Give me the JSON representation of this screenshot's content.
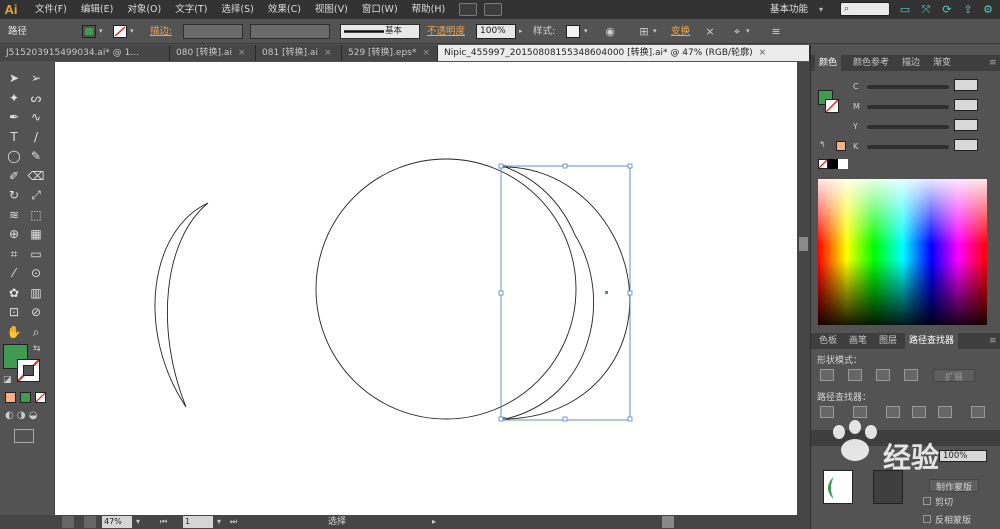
{
  "app": {
    "logo": "Ai"
  },
  "menu": [
    "文件(F)",
    "编辑(E)",
    "对象(O)",
    "文字(T)",
    "选择(S)",
    "效果(C)",
    "视图(V)",
    "窗口(W)",
    "帮助(H)"
  ],
  "workspace": {
    "label": "基本功能",
    "arrow": "▾"
  },
  "controlbar": {
    "selection_label": "路径",
    "stroke_label": "描边",
    "stroke_sep": ":",
    "brush_label": "基本",
    "opacity_label": "不透明度",
    "opacity_value": "100%",
    "style_label": "样式",
    "style_sep": ":",
    "transform_label": "变换",
    "fill_color": "#3e9b4f"
  },
  "tabs": [
    {
      "label": "J515203915499034.ai* @ 1...",
      "active": false
    },
    {
      "label": "080 [转换].ai",
      "active": false
    },
    {
      "label": "081 [转换].ai",
      "active": false
    },
    {
      "label": "529 [转换].eps*",
      "active": false
    },
    {
      "label": "Nipic_455997_20150808155348604000 [转换].ai* @ 47% (RGB/轮廓)",
      "active": true
    }
  ],
  "tab_close": "×",
  "tools": [
    "selection-tool",
    "direct-selection-tool",
    "magic-wand-tool",
    "lasso-tool",
    "pen-tool",
    "curvature-tool",
    "type-tool",
    "line-tool",
    "ellipse-tool",
    "paintbrush-tool",
    "pencil-tool",
    "eraser-tool",
    "rotate-tool",
    "scale-tool",
    "warp-tool",
    "free-transform-tool",
    "shape-builder-tool",
    "perspective-tool",
    "mesh-tool",
    "gradient-tool",
    "eyedropper-tool",
    "blend-tool",
    "symbol-sprayer-tool",
    "graph-tool",
    "artboard-tool",
    "slice-tool",
    "hand-tool",
    "zoom-tool"
  ],
  "tool_glyphs": [
    "➤",
    "➢",
    "✦",
    "ᔕ",
    "✒",
    "∿",
    "T",
    "/",
    "◯",
    "✎",
    "✐",
    "⌫",
    "↻",
    "⤢",
    "≋",
    "⬚",
    "⊕",
    "▦",
    "⌗",
    "▭",
    "⁄",
    "⊙",
    "✿",
    "▥",
    "⊡",
    "⊘",
    "✋",
    "⌕"
  ],
  "fill_color": "#3e9b4f",
  "statusbar": {
    "zoom": "47%",
    "page": "1",
    "tool": "选择"
  },
  "color_panel": {
    "tabs": [
      "颜色",
      "颜色参考",
      "描边",
      "渐变"
    ],
    "channels": [
      "C",
      "M",
      "Y",
      "K"
    ],
    "fill_color": "#3e9b4f",
    "last_color": "#f4b183"
  },
  "swatches_panel": {
    "tabs": [
      "色板",
      "画笔",
      "图层",
      "路径查找器"
    ],
    "shape_modes_label": "形状模式：",
    "expand_label": "扩展",
    "pathfinder_label": "路径查找器："
  },
  "transparency_panel": {
    "value": "100%",
    "make_mask_label": "制作蒙版",
    "clip_label": "剪切",
    "invert_mask_label": "反相蒙版"
  },
  "watermark": {
    "text": "经验"
  }
}
